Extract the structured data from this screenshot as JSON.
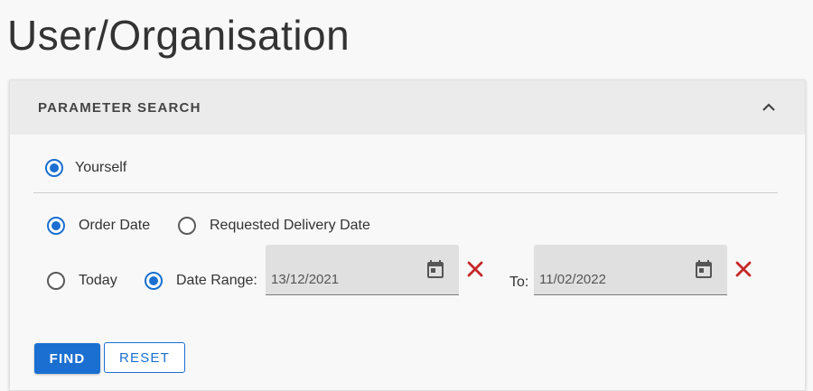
{
  "page": {
    "title": "User/Organisation"
  },
  "panel": {
    "header_title": "PARAMETER SEARCH",
    "collapse_icon": "chevron-up-icon"
  },
  "scope": {
    "options": [
      {
        "label": "Yourself",
        "selected": true
      }
    ]
  },
  "date_type": {
    "options": [
      {
        "label": "Order Date",
        "selected": true
      },
      {
        "label": "Requested Delivery Date",
        "selected": false
      }
    ]
  },
  "date_mode": {
    "options": [
      {
        "label": "Today",
        "selected": false
      },
      {
        "label": "Date Range:",
        "selected": true
      }
    ]
  },
  "from_date": {
    "value": "13/12/2021",
    "icon": "calendar-icon"
  },
  "to_date": {
    "label": "To:",
    "value": "11/02/2022",
    "icon": "calendar-icon"
  },
  "actions": {
    "find_label": "FIND",
    "reset_label": "RESET"
  },
  "colors": {
    "accent": "#1a6fd1",
    "clear": "#c62828"
  }
}
